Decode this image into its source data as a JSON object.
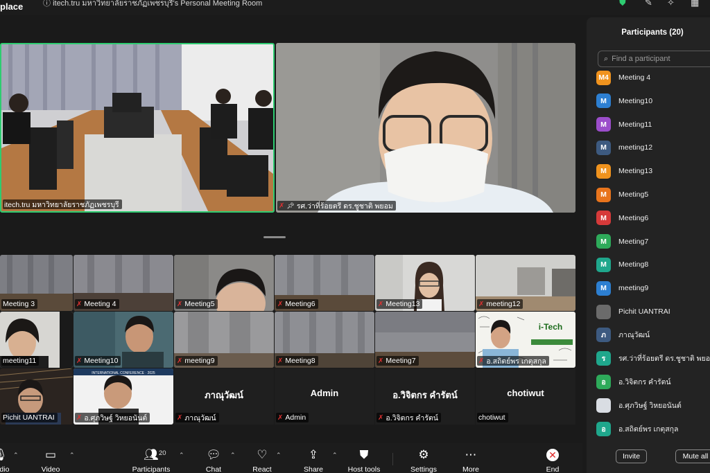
{
  "topbar": {
    "brand": "place",
    "title": "itech.tru มหาวิทยาลัยราชภัฏเพชรบุรี's Personal Meeting Room"
  },
  "colors": {
    "active_speaker_border": "#2ecc71",
    "muted_red": "#e03131",
    "panel_bg": "#232323"
  },
  "main_videos": {
    "left_name": "itech.tru มหาวิทยาลัยราชภัฏเพชรบุรี",
    "right_name": "รศ.ว่าที่ร้อยตรี ดร.ชูชาติ พยอม"
  },
  "gallery": [
    {
      "name": "Meeting 3"
    },
    {
      "name": "Meeting 4"
    },
    {
      "name": "Meeting5"
    },
    {
      "name": "Meeting6"
    },
    {
      "name": "Meeting13"
    },
    {
      "name": "meeting12"
    },
    {
      "name": "meeting11"
    },
    {
      "name": "Meeting10"
    },
    {
      "name": "meeting9"
    },
    {
      "name": "Meeting8"
    },
    {
      "name": "Meeting7"
    },
    {
      "name": "อ.สถิตย์พร เกตุสกุล"
    },
    {
      "name": "Pichit UANTRAI"
    },
    {
      "name": "อ.ศุภวิษฐ์ วิหยอนันต์"
    },
    {
      "name": "ภาณุวัฒน์",
      "display": "ภาณุวัฒน์"
    },
    {
      "name": "Admin",
      "display": "Admin"
    },
    {
      "name": "อ.วิจิตกร คำรัตน์",
      "display": "อ.วิจิตกร คำรัตน์"
    },
    {
      "name": "chotiwut",
      "display": "chotiwut"
    }
  ],
  "poster_text": "INTERNATIONAL CONFERENCE · 2025",
  "itech_logo": "i-Tech",
  "toolbar": {
    "audio": "Audio",
    "video": "Video",
    "participants": "Participants",
    "participants_count": "20",
    "chat": "Chat",
    "react": "React",
    "share": "Share",
    "host_tools": "Host tools",
    "settings": "Settings",
    "more": "More",
    "end": "End"
  },
  "panel": {
    "title": "Participants (20)",
    "search_placeholder": "Find a participant",
    "invite": "Invite",
    "mute_all": "Mute all",
    "participants": [
      {
        "initials": "M4",
        "name": "Meeting 4",
        "color": "#f0931e"
      },
      {
        "initials": "M",
        "name": "Meeting10",
        "color": "#2d7fd1"
      },
      {
        "initials": "M",
        "name": "Meeting11",
        "color": "#9b4dca"
      },
      {
        "initials": "M",
        "name": "meeting12",
        "color": "#3d5a80"
      },
      {
        "initials": "M",
        "name": "Meeting13",
        "color": "#f0931e"
      },
      {
        "initials": "M",
        "name": "Meeting5",
        "color": "#e8741c"
      },
      {
        "initials": "M",
        "name": "Meeting6",
        "color": "#d63a3a"
      },
      {
        "initials": "M",
        "name": "Meeting7",
        "color": "#2eaa5a"
      },
      {
        "initials": "M",
        "name": "Meeting8",
        "color": "#1fa78c"
      },
      {
        "initials": "M",
        "name": "meeting9",
        "color": "#2d7fd1"
      },
      {
        "initials": "",
        "name": "Pichit UANTRAI",
        "color": "#6b6b6b"
      },
      {
        "initials": "ภ",
        "name": "ภาณุวัฒน์",
        "color": "#3d5a80"
      },
      {
        "initials": "ร",
        "name": "รศ.ว่าที่ร้อยตรี ดร.ชูชาติ พยอม",
        "color": "#1fa78c"
      },
      {
        "initials": "อ",
        "name": "อ.วิจิตกร คำรัตน์",
        "color": "#2eaa5a"
      },
      {
        "initials": "",
        "name": "อ.ศุภวิษฐ์ วิหยอนันต์",
        "color": "#d9dde3"
      },
      {
        "initials": "อ",
        "name": "อ.สถิตย์พร เกตุสกุล",
        "color": "#1fa78c"
      }
    ]
  }
}
